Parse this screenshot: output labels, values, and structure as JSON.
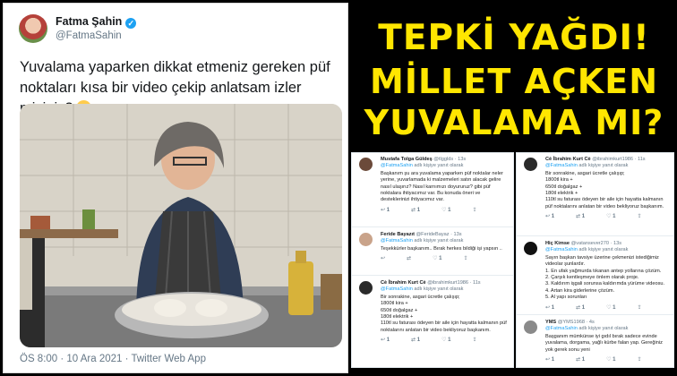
{
  "tweet": {
    "display_name": "Fatma Şahin",
    "handle": "@FatmaSahin",
    "text": "Yuvalama yaparken dikkat etmeniz gereken püf noktaları kısa bir video çekip anlatsam izler misiniz?",
    "meta": "ÖS 8:00 · 10 Ara 2021 · Twitter Web App"
  },
  "headline": {
    "line1": "TEPKİ YAĞDI!",
    "line2": "MİLLET AÇKEN",
    "line3": "YUVALAMA MI?"
  },
  "replies_left": [
    {
      "name": "Mustafa Tolga Güldeş",
      "handle": "@tlgglds · 13s",
      "to": "@FatmaSahin",
      "to_suffix": " adlı kişiye yanıt olarak",
      "body": "Başkanım şu ara yuvalama yaparken püf noktalar neler yerine, yuvarlamada ki malzemeleri satın alacak gelire nasıl ulaşırız? Nasıl karnımızı doyururuz? gibi püf noktalara ihtiyacımız var. Bu konuda öneri ve desteklerinizi ihtiyacımız var.",
      "actions": [
        "1",
        "1",
        "1",
        "1"
      ],
      "avatar_color": "#6b4a3a"
    },
    {
      "name": "Feride Bayazıt",
      "handle": "@FerideBayaz · 13s",
      "to": "@FatmaSahin",
      "to_suffix": " adlı kişiye yanıt olarak",
      "body": "Teşekkürler başkanım.. Bırak herkes bildiği işi yapsın ..",
      "actions": [
        "",
        "",
        "1",
        ""
      ],
      "avatar_color": "#c9a38a"
    },
    {
      "name": "Cè İbrahim Kurt Cè",
      "handle": "@ibrahimkurt1986 · 11s",
      "to": "@FatmaSahin",
      "to_suffix": " adlı kişiye yanıt olarak",
      "body": "Bir sonrakine, asgari ücretle çalışıp;\n1800tl kira +\n650tl doğalgaz +\n180tl elektrik +\n110tl su faturası ödeyen bir aile için hayatta kalmanın püf noktalarını anlatan bir video bekliyoruz başkanım.",
      "actions": [
        "1",
        "1",
        "1",
        "1"
      ],
      "avatar_color": "#2a2a2a"
    }
  ],
  "replies_right": [
    {
      "name": "Cè İbrahim Kurt Cè",
      "handle": "@ibrahimkurt1986 · 11s",
      "to": "@FatmaSahin",
      "to_suffix": " adlı kişiye yanıt olarak",
      "body": "Bir sonrakine, asgari ücretle çalışıp;\n1800tl kira +\n650tl doğalgaz +\n180tl elektrik +\n110tl su faturası ödeyen bir aile için hayatta kalmanın püf noktalarını anlatan bir video bekliyoruz başkanım.",
      "actions": [
        "1",
        "1",
        "1",
        "1"
      ],
      "avatar_color": "#2a2a2a"
    },
    {
      "name": "Hiç Kimse",
      "handle": "@vatansever270 · 13s",
      "to": "@FatmaSahin",
      "to_suffix": " adlı kişiye yanıt olarak",
      "body": "Sayın başkan tavsiye üzerine çekmenizi istediğimiz videolar şunlardır.\n1. En ufak yağmurda tıkanan antep yollarına çözüm.\n2. Çarşık kentleşmeye önlem olarak proje.\n3. Kaldırım işgali sorunsa kaldırımda yürüme videosu.\n4. Artan kira giderlerine çözüm.\n5. Al yapı sorunları",
      "actions": [
        "1",
        "1",
        "1",
        "1"
      ],
      "avatar_color": "#111111"
    },
    {
      "name": "YMS",
      "handle": "@YMS1968 · 4s",
      "to": "@FatmaSahin",
      "to_suffix": " adlı kişiye yanıt olarak",
      "body": "Başganım mümkünse iyi gıdıl bırak sadece evinde yuvalama, dorgama, yağlı kürbe falan yap. Gereğiniz yok gerek sonu yeni",
      "actions": [
        "1",
        "1",
        "1",
        "1"
      ],
      "avatar_color": "#8a8a8a"
    }
  ]
}
